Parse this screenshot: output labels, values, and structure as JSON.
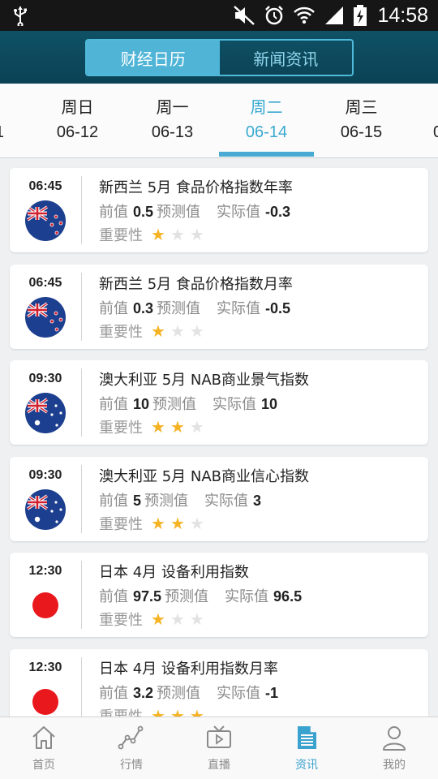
{
  "status_bar": {
    "time": "14:58"
  },
  "header": {
    "tabs": [
      {
        "label": "财经日历",
        "active": true
      },
      {
        "label": "新闻资讯",
        "active": false
      }
    ]
  },
  "date_tabs": [
    {
      "weekday": "",
      "date": "1"
    },
    {
      "weekday": "周日",
      "date": "06-12"
    },
    {
      "weekday": "周一",
      "date": "06-13"
    },
    {
      "weekday": "周二",
      "date": "06-14",
      "active": true
    },
    {
      "weekday": "周三",
      "date": "06-15"
    },
    {
      "weekday": "",
      "date": "0"
    }
  ],
  "labels": {
    "previous": "前值",
    "forecast": "预测值",
    "actual": "实际值",
    "importance": "重要性"
  },
  "events": [
    {
      "time": "06:45",
      "flag": "new-zealand",
      "title": "新西兰 5月 食品价格指数年率",
      "previous": "0.5",
      "forecast": "",
      "actual": "-0.3",
      "importance": 1
    },
    {
      "time": "06:45",
      "flag": "new-zealand",
      "title": "新西兰 5月 食品价格指数月率",
      "previous": "0.3",
      "forecast": "",
      "actual": "-0.5",
      "importance": 1
    },
    {
      "time": "09:30",
      "flag": "australia",
      "title": "澳大利亚 5月 NAB商业景气指数",
      "previous": "10",
      "forecast": "",
      "actual": "10",
      "importance": 2
    },
    {
      "time": "09:30",
      "flag": "australia",
      "title": "澳大利亚 5月 NAB商业信心指数",
      "previous": "5",
      "forecast": "",
      "actual": "3",
      "importance": 2
    },
    {
      "time": "12:30",
      "flag": "japan",
      "title": "日本 4月 设备利用指数",
      "previous": "97.5",
      "forecast": "",
      "actual": "96.5",
      "importance": 1
    },
    {
      "time": "12:30",
      "flag": "japan",
      "title": "日本 4月 设备利用指数月率",
      "previous": "3.2",
      "forecast": "",
      "actual": "-1",
      "importance": 3
    }
  ],
  "bottom_nav": [
    {
      "label": "首页",
      "icon": "home-icon"
    },
    {
      "label": "行情",
      "icon": "chart-icon"
    },
    {
      "label": "直播",
      "icon": "tv-icon"
    },
    {
      "label": "资讯",
      "icon": "news-icon",
      "active": true
    },
    {
      "label": "我的",
      "icon": "user-icon"
    }
  ],
  "colors": {
    "accent": "#3aa9d1",
    "header": "#0f5166",
    "star_on": "#f5b324",
    "star_off": "#e2e2e2"
  }
}
